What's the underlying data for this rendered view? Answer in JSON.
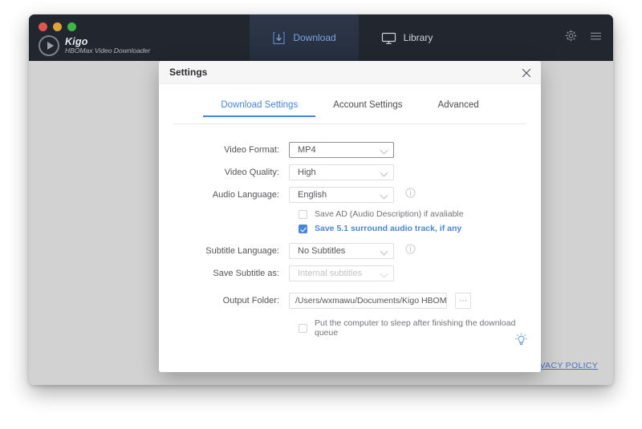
{
  "app": {
    "brand_name": "Kigo",
    "brand_subtitle": "HBOMax Video Downloader",
    "nav": [
      {
        "label": "Download",
        "icon": "download-icon",
        "active": true
      },
      {
        "label": "Library",
        "icon": "monitor-icon",
        "active": false
      }
    ],
    "window_actions": [
      {
        "name": "settings-gear-icon"
      },
      {
        "name": "menu-hamburger-icon"
      }
    ],
    "privacy_policy": "PRIVACY POLICY"
  },
  "dialog": {
    "title": "Settings",
    "close_label": "×",
    "tabs": [
      {
        "label": "Download Settings",
        "active": true
      },
      {
        "label": "Account Settings",
        "active": false
      },
      {
        "label": "Advanced",
        "active": false
      }
    ],
    "fields": {
      "video_format": {
        "label": "Video Format:",
        "value": "MP4"
      },
      "video_quality": {
        "label": "Video Quality:",
        "value": "High"
      },
      "audio_language": {
        "label": "Audio Language:",
        "value": "English"
      },
      "subtitle_language": {
        "label": "Subtitle Language:",
        "value": "No Subtitles"
      },
      "save_subtitle_as": {
        "label": "Save Subtitle as:",
        "value": "Internal subtitles"
      },
      "output_folder": {
        "label": "Output Folder:",
        "value": "/Users/wxmawu/Documents/Kigo HBOMax Vid",
        "browse_label": "⋯"
      }
    },
    "checkboxes": {
      "save_ad": {
        "label": "Save AD (Audio Description) if avaliable",
        "checked": false
      },
      "save_surround": {
        "label": "Save 5.1 surround audio track, if any",
        "checked": true
      },
      "sleep_after": {
        "label": "Put the computer to sleep after finishing the download queue",
        "checked": false
      }
    }
  },
  "colors": {
    "accent": "#4a86d8",
    "titlebar": "#22272f",
    "app_body": "#d2d2d2",
    "link": "#4a6fc4"
  }
}
